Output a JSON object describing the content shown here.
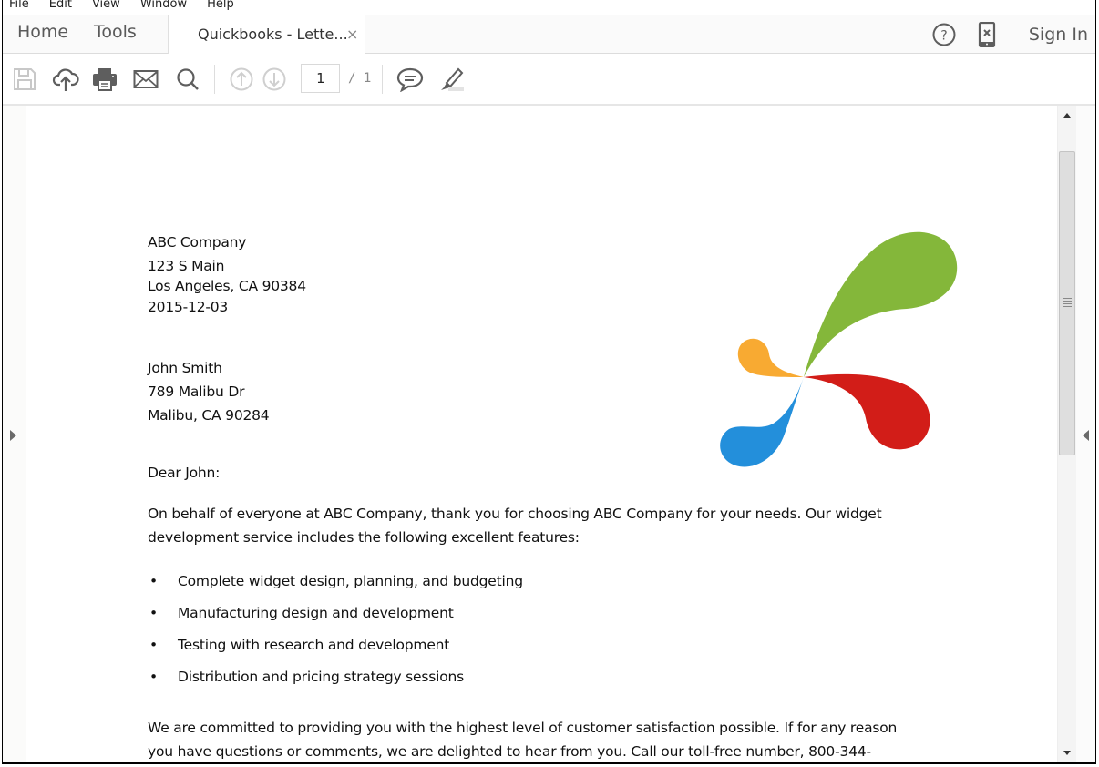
{
  "menu": [
    "File",
    "Edit",
    "View",
    "Window",
    "Help"
  ],
  "tabs": {
    "home": "Home",
    "tools": "Tools",
    "document": "Quickbooks - Lette...",
    "close_glyph": "×"
  },
  "header_right": {
    "help_icon": "help-circle-icon",
    "mobile_icon": "mobile-link-icon",
    "sign_in": "Sign In"
  },
  "toolbar": {
    "icons": [
      "save-icon",
      "cloud-upload-icon",
      "print-icon",
      "email-icon",
      "search-icon",
      "previous-page-icon",
      "next-page-icon",
      "comment-icon",
      "highlight-icon"
    ],
    "page_current": "1",
    "page_total": "/ 1"
  },
  "colors": {
    "logo_green": "#84b73a",
    "logo_orange": "#f8aa32",
    "logo_red": "#d21d18",
    "logo_blue": "#238fdb"
  },
  "letter": {
    "sender": [
      "ABC Company",
      "123 S Main",
      "Los Angeles, CA 90384",
      "2015-12-03"
    ],
    "recipient": [
      "John Smith",
      "789 Malibu Dr",
      "Malibu, CA 90284"
    ],
    "salutation": "Dear John:",
    "intro": [
      "On behalf of everyone at ABC Company, thank you for choosing ABC Company for your needs. Our widget",
      "development service includes the following excellent features:"
    ],
    "bullet_glyph": "•",
    "features": [
      "Complete widget design, planning, and budgeting",
      "Manufacturing design and development",
      "Testing with research and development",
      "Distribution and pricing strategy sessions"
    ],
    "closing": [
      "We are committed to providing you with the highest level of customer satisfaction possible. If for any reason",
      "you have questions or comments, we are delighted to hear from you. Call our toll-free number, 800-344-"
    ]
  }
}
